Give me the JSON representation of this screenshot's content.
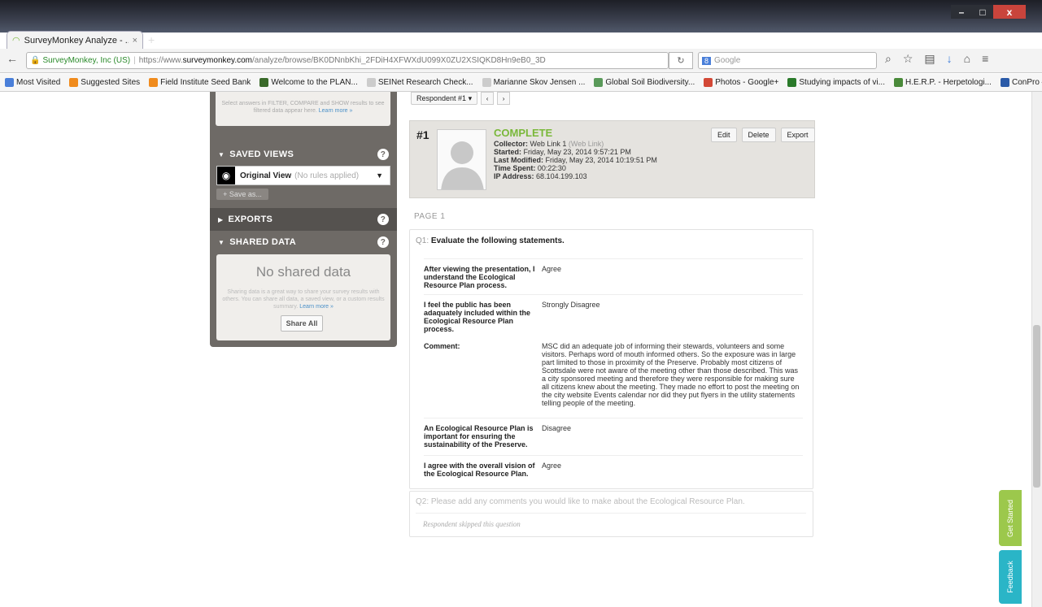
{
  "browser": {
    "tab_title": "SurveyMonkey Analyze - ...",
    "tab_close": "×",
    "new_tab": "+",
    "window_controls": [
      "–",
      "□",
      "x"
    ],
    "url": {
      "org": "SurveyMonkey, Inc (US)",
      "scheme": "https://www.",
      "host": "surveymonkey.com",
      "path": "/analyze/browse/BK0DNnbKhi_2FDiH4XFWXdU099X0ZU2XSIQKD8Hn9eB0_3D"
    },
    "search_placeholder": "Google",
    "bookmarks": [
      {
        "label": "Most Visited",
        "color": "#4a7fd9"
      },
      {
        "label": "Suggested Sites",
        "color": "#f08b1d"
      },
      {
        "label": "Field Institute Seed Bank",
        "color": "#f08b1d"
      },
      {
        "label": "Welcome to the PLAN...",
        "color": "#3a6a2a"
      },
      {
        "label": "SEINet Research Check...",
        "color": "#cccccc"
      },
      {
        "label": "Marianne Skov Jensen ...",
        "color": "#cccccc"
      },
      {
        "label": "Global Soil Biodiversity...",
        "color": "#5a9a5a"
      },
      {
        "label": "Photos - Google+",
        "color": "#d34836"
      },
      {
        "label": "Studying impacts of vi...",
        "color": "#2a7a2a"
      },
      {
        "label": "H.E.R.P. - Herpetologi...",
        "color": "#4a8a3a"
      },
      {
        "label": "ConPro — ConPro",
        "color": "#2a5aa8"
      }
    ]
  },
  "sidebar": {
    "top_info": "Select answers in FILTER, COMPARE and SHOW results to see filtered data appear here.",
    "top_info_link": "Learn more »",
    "saved_views": {
      "title": "SAVED VIEWS",
      "view_name": "Original View",
      "view_sub": "(No rules applied)",
      "save_as": "+ Save as..."
    },
    "exports": {
      "title": "EXPORTS"
    },
    "shared_data": {
      "title": "SHARED DATA",
      "empty": "No shared data",
      "desc": "Sharing data is a great way to share your survey results with others. You can share all data, a saved view, or a custom results summary.",
      "link": "Learn more »",
      "button": "Share All"
    },
    "help_icon": "?"
  },
  "respondent_nav": {
    "dropdown": "Respondent #1",
    "prev": "‹",
    "next": "›"
  },
  "respondent": {
    "number": "#1",
    "status": "COMPLETE",
    "collector_label": "Collector:",
    "collector": "Web Link 1",
    "collector_type": "(Web Link)",
    "started_label": "Started:",
    "started": "Friday, May 23, 2014 9:57:21 PM",
    "modified_label": "Last Modified:",
    "modified": "Friday, May 23, 2014 10:19:51 PM",
    "time_label": "Time Spent:",
    "time": "00:22:30",
    "ip_label": "IP Address:",
    "ip": "68.104.199.103",
    "buttons": {
      "edit": "Edit",
      "delete": "Delete",
      "export": "Export"
    }
  },
  "page_label": "PAGE 1",
  "q1": {
    "num": "Q1:",
    "title": "Evaluate the following statements.",
    "rows": [
      {
        "label": "After viewing the presentation, I understand the Ecological Resource Plan process.",
        "answer": "Agree"
      },
      {
        "label": "I feel the public has been adaquately included within the Ecological Resource Plan process.",
        "answer": "Strongly Disagree"
      },
      {
        "label": "Comment:",
        "answer": "MSC did an adequate job of informing their stewards, volunteers and some visitors. Perhaps word of mouth informed others. So the exposure was in large part limited to those in proximity of the Preserve. Probably most citizens of Scottsdale were not aware of the meeting other than those described. This was a city sponsored meeting and therefore they were responsible for making sure all citizens knew about the meeting. They made no effort to post the meeting on the city website Events calendar nor did they put flyers in the utility statements telling people of the meeting."
      },
      {
        "label": "An Ecological Resource Plan is important for ensuring the sustainability of the Preserve.",
        "answer": "Disagree"
      },
      {
        "label": "I agree with the overall vision of the Ecological Resource Plan.",
        "answer": "Agree"
      }
    ]
  },
  "q2": {
    "title": "Q2: Please add any comments you would like to make about the Ecological Resource Plan.",
    "skipped": "Respondent skipped this question"
  },
  "side_tabs": {
    "get_started": "Get Started",
    "feedback": "Feedback"
  }
}
